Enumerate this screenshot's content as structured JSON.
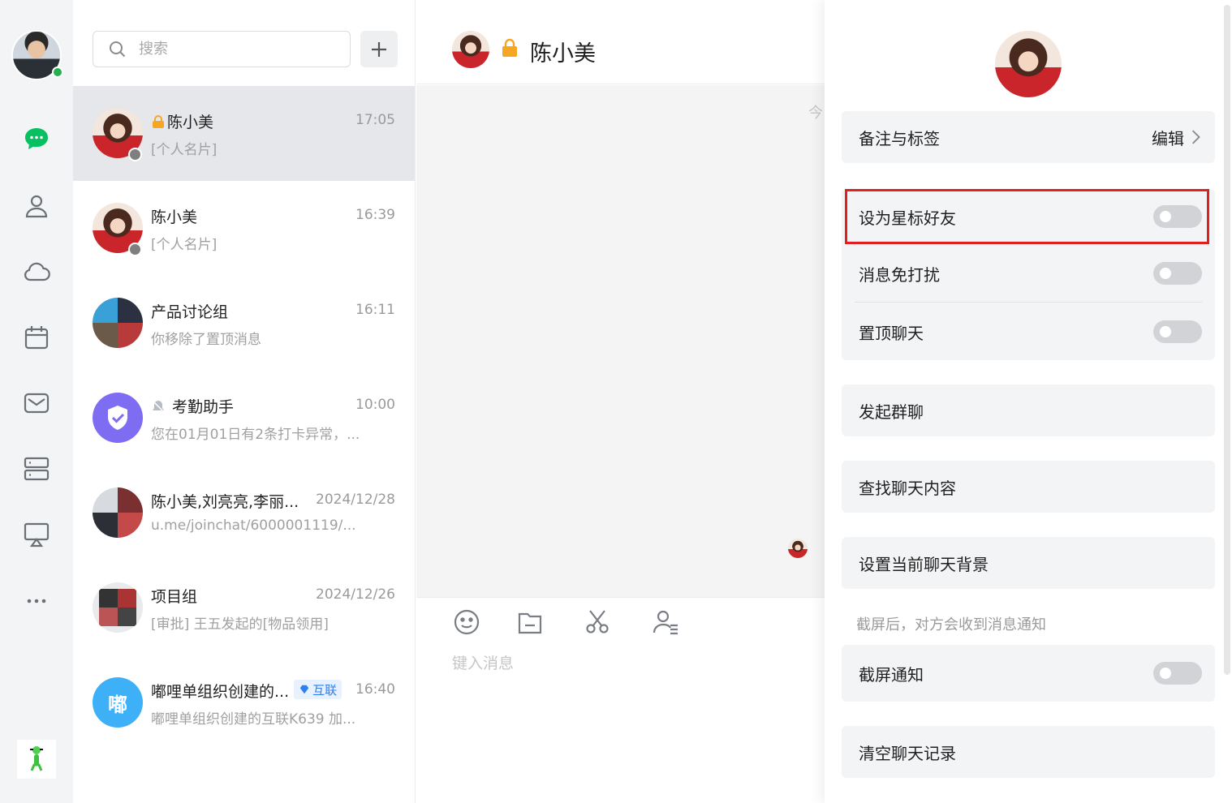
{
  "rail": {
    "icons": [
      "chat-icon",
      "contacts-icon",
      "cloud-icon",
      "calendar-icon",
      "mail-icon",
      "workbench-icon",
      "screen-share-icon",
      "more-icon"
    ],
    "accent": "#07c160"
  },
  "search": {
    "placeholder": "搜索"
  },
  "conversations": [
    {
      "name": "陈小美",
      "time": "17:05",
      "preview": "[个人名片]"
    },
    {
      "name": "陈小美",
      "time": "16:39",
      "preview": "[个人名片]"
    },
    {
      "name": "产品讨论组",
      "time": "16:11",
      "preview": "你移除了置顶消息"
    },
    {
      "name": "考勤助手",
      "time": "10:00",
      "preview": "您在01月01日有2条打卡异常，..."
    },
    {
      "name": "陈小美,刘亮亮,李丽...",
      "time": "2024/12/28",
      "preview": "u.me/joinchat/6000001119/..."
    },
    {
      "name": "项目组",
      "time": "2024/12/26",
      "preview": "[审批] 王五发起的[物品领用]"
    },
    {
      "name": "嘟哩单组织创建的...",
      "badge": "互联",
      "time": "16:40",
      "preview": "嘟哩单组织创建的互联K639 加...",
      "avatar_text": "嘟"
    }
  ],
  "chat": {
    "title": "陈小美",
    "date_stub": "今",
    "input_placeholder": "键入消息"
  },
  "drawer": {
    "remark": {
      "label": "备注与标签",
      "action": "编辑"
    },
    "star_friend": {
      "label": "设为星标好友",
      "on": false
    },
    "mute": {
      "label": "消息免打扰",
      "on": false
    },
    "pin": {
      "label": "置顶聊天",
      "on": false
    },
    "start_group": {
      "label": "发起群聊"
    },
    "search_history": {
      "label": "查找聊天内容"
    },
    "set_background": {
      "label": "设置当前聊天背景"
    },
    "screenshot_hint": "截屏后，对方会收到消息通知",
    "screenshot_notify": {
      "label": "截屏通知",
      "on": false
    },
    "clear_history": {
      "label": "清空聊天记录"
    }
  },
  "colors": {
    "highlight": "#e02020",
    "toggle_off": "#d2d3d6",
    "active_row": "#e6e7ea"
  }
}
